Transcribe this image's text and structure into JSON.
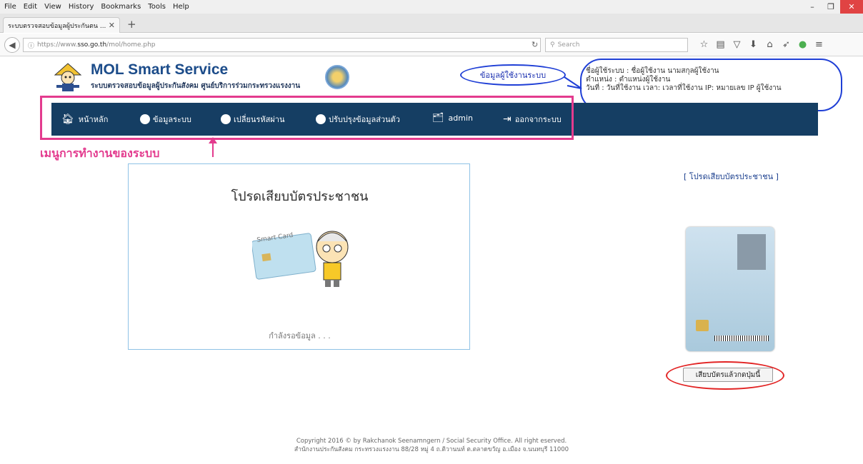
{
  "browser": {
    "menu": [
      "File",
      "Edit",
      "View",
      "History",
      "Bookmarks",
      "Tools",
      "Help"
    ],
    "tab_title": "ระบบตรวจสอบข้อมูลผู้ประกันตน ...",
    "url_prefix": "https://www.",
    "url_host": "sso.go.th",
    "url_path": "/mol/home.php",
    "search_placeholder": "Search"
  },
  "site": {
    "title": "MOL Smart Service",
    "subtitle": "ระบบตรวจสอบข้อมูลผู้ประกันสังคม ศูนย์บริการร่วมกระทรวงแรงงาน"
  },
  "callout": "ข้อมูลผู้ใช้งานระบบ",
  "user_info": {
    "line1": "ชื่อผู้ใช้ระบบ : ชื่อผู้ใช้งาน  นามสกุลผู้ใช้งาน",
    "line2": "ตำแหน่ง : ตำแหน่งผู้ใช้งาน",
    "line3": "วันที่ : วันที่ใช้งาน    เวลา: เวลาที่ใช้งาน   IP: หมายเลข IP ผู้ใช้งาน"
  },
  "menu": {
    "home": "หน้าหลัก",
    "system": "ข้อมูลระบบ",
    "password": "เปลี่ยนรหัสผ่าน",
    "profile": "ปรับปรุงข้อมูลส่วนตัว",
    "admin": "admin",
    "logout": "ออกจากระบบ"
  },
  "menu_annotation": "เมนูการทำงานของระบบ",
  "panel": {
    "title": "โปรดเสียบบัตรประชาชน",
    "card_label": "Smart Card",
    "loading": "กำลังรอข้อมูล . . ."
  },
  "right": {
    "link": "[ โปรดเสียบบัตรประชาชน ]",
    "button": "เสียบบัตรแล้วกดปุ่มนี้"
  },
  "footer": {
    "line1": "Copyright 2016 © by Rakchanok Seenamngern / Social Security Office. All right eserved.",
    "line2": "สำนักงานประกันสังคม กระทรวงแรงงาน 88/28 หมู่ 4 ถ.ติวานนท์ ต.ตลาดขวัญ อ.เมือง จ.นนทบุรี 11000"
  },
  "colors": {
    "menu_bg": "#153e63",
    "annotation_pink": "#e33b8e",
    "annotation_blue": "#1f3fd6",
    "annotation_red": "#e22424"
  }
}
